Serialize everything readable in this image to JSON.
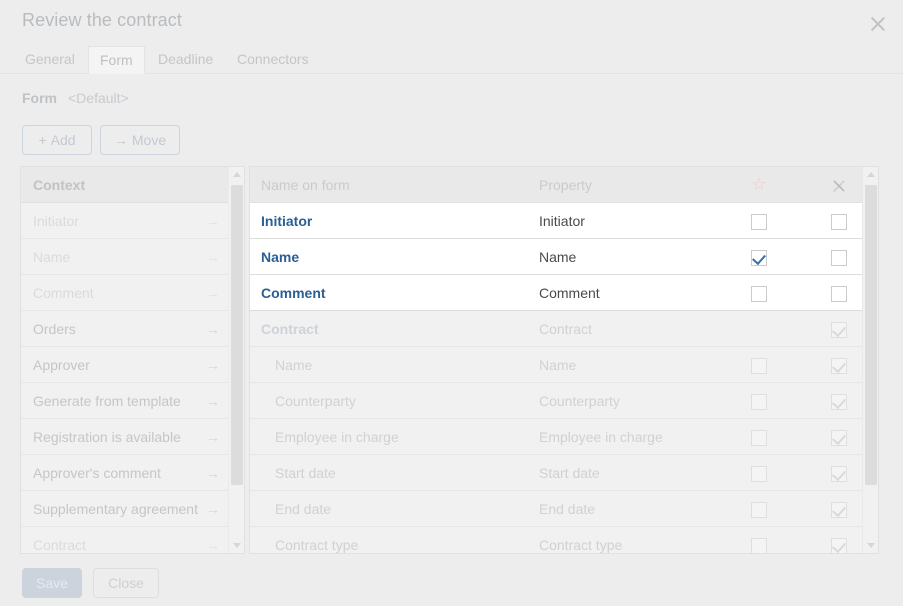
{
  "dialog": {
    "title": "Review the contract",
    "close_icon": "close-icon"
  },
  "tabs": [
    {
      "label": "General",
      "active": false
    },
    {
      "label": "Form",
      "active": true
    },
    {
      "label": "Deadline",
      "active": false
    },
    {
      "label": "Connectors",
      "active": false
    }
  ],
  "form_row": {
    "label": "Form",
    "value": "<Default>"
  },
  "toolbar": {
    "add_glyph": "+",
    "add_label": "Add",
    "move_glyph": "→",
    "move_label": "Move"
  },
  "context_panel": {
    "header": "Context",
    "arrow_glyph": "→",
    "items": [
      {
        "label": "Initiator",
        "dim": true
      },
      {
        "label": "Name",
        "dim": true
      },
      {
        "label": "Comment",
        "dim": true
      },
      {
        "label": "Orders",
        "dim": false
      },
      {
        "label": "Approver",
        "dim": false
      },
      {
        "label": "Generate from template",
        "dim": false
      },
      {
        "label": "Registration is available",
        "dim": false
      },
      {
        "label": "Approver's comment",
        "dim": false
      },
      {
        "label": "Supplementary agreement",
        "dim": false
      },
      {
        "label": "Contract",
        "dim": true
      }
    ]
  },
  "table": {
    "columns": {
      "name_on_form": "Name on form",
      "property": "Property",
      "star_icon": "star-icon",
      "edit_disabled_icon": "pencil-crossed-icon"
    },
    "rows": [
      {
        "name": "Initiator",
        "property": "Initiator",
        "state": "active",
        "starred": false,
        "locked": false
      },
      {
        "name": "Name",
        "property": "Name",
        "state": "active",
        "starred": true,
        "locked": false
      },
      {
        "name": "Comment",
        "property": "Comment",
        "state": "active",
        "starred": false,
        "locked": false
      },
      {
        "name": "Contract",
        "property": "Contract",
        "state": "group",
        "starred": false,
        "locked": true
      },
      {
        "name": "Name",
        "property": "Name",
        "state": "child",
        "starred": false,
        "locked": true
      },
      {
        "name": "Counterparty",
        "property": "Counterparty",
        "state": "child",
        "starred": false,
        "locked": true
      },
      {
        "name": "Employee in charge",
        "property": "Employee in charge",
        "state": "child",
        "starred": false,
        "locked": true
      },
      {
        "name": "Start date",
        "property": "Start date",
        "state": "child",
        "starred": false,
        "locked": true
      },
      {
        "name": "End date",
        "property": "End date",
        "state": "child",
        "starred": false,
        "locked": true
      },
      {
        "name": "Contract type",
        "property": "Contract type",
        "state": "child",
        "starred": false,
        "locked": true
      }
    ]
  },
  "footer": {
    "save_label": "Save",
    "close_label": "Close"
  },
  "colors": {
    "page_background": "#ededed",
    "link": "#2a5f96",
    "star": "#eecdcd",
    "checkmark": "#3571a8",
    "save_button": "#ccd3dc"
  }
}
